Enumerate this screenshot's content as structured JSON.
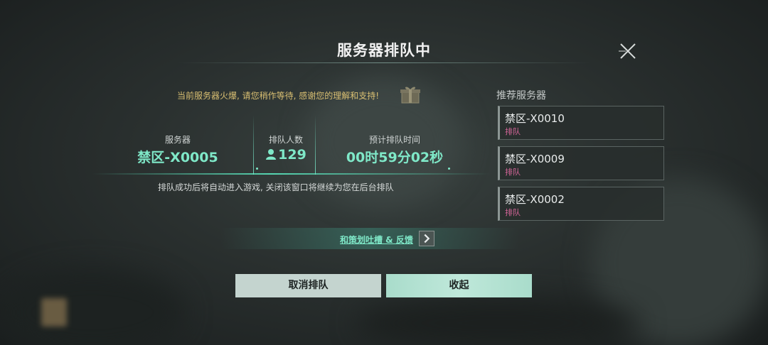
{
  "dialog": {
    "title": "服务器排队中",
    "notice": "当前服务器火爆, 请您稍作等待, 感谢您的理解和支持!",
    "info": {
      "server_label": "服务器",
      "server_value": "禁区-X0005",
      "queue_label": "排队人数",
      "queue_value": "129",
      "time_label": "预计排队时间",
      "time_value": "00时59分02秒"
    },
    "hint": "排队成功后将自动进入游戏, 关闭该窗口将继续为您在后台排队",
    "feedback_label": "和策划吐槽 & 反馈",
    "cancel_label": "取消排队",
    "collapse_label": "收起"
  },
  "recommended": {
    "title": "推荐服务器",
    "servers": [
      {
        "name": "禁区-X0010",
        "status": "排队"
      },
      {
        "name": "禁区-X0009",
        "status": "排队"
      },
      {
        "name": "禁区-X0002",
        "status": "排队"
      }
    ]
  },
  "colors": {
    "accent_teal": "#7fe8c8",
    "notice_gold": "#d9bf72",
    "status_pink": "#d6669a",
    "button_bg": "#c4d4cf"
  },
  "icons": [
    "close-icon",
    "gift-icon",
    "person-icon",
    "chevron-right-icon"
  ]
}
